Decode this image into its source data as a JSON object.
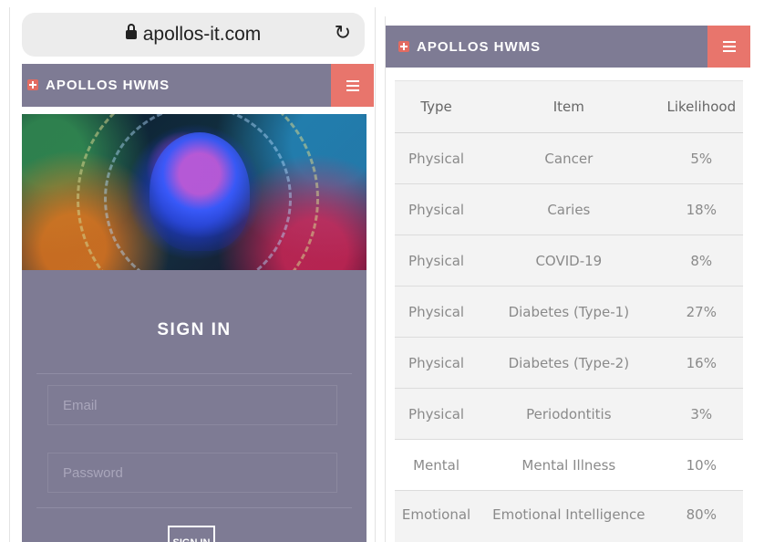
{
  "browser": {
    "url": "apollos-it.com"
  },
  "header": {
    "brand": "APOLLOS HWMS"
  },
  "signin": {
    "title": "SIGN IN",
    "email_placeholder": "Email",
    "password_placeholder": "Password",
    "button_label": "SIGN IN"
  },
  "table": {
    "columns": [
      "Type",
      "Item",
      "Likelihood"
    ],
    "rows": [
      [
        "Physical",
        "Cancer",
        "5%"
      ],
      [
        "Physical",
        "Caries",
        "18%"
      ],
      [
        "Physical",
        "COVID-19",
        "8%"
      ],
      [
        "Physical",
        "Diabetes (Type-1)",
        "27%"
      ],
      [
        "Physical",
        "Diabetes (Type-2)",
        "16%"
      ],
      [
        "Physical",
        "Periodontitis",
        "3%"
      ],
      [
        "Mental",
        "Mental Illness",
        "10%"
      ],
      [
        "Emotional",
        "Emotional Intelligence",
        "80%"
      ]
    ]
  },
  "colors": {
    "header_bg": "#7e7b94",
    "menu_button": "#e8756c",
    "logo_accent": "#e36b61"
  },
  "icons": [
    "lock-icon",
    "reload-icon",
    "plus-logo-icon",
    "hamburger-menu-icon"
  ]
}
